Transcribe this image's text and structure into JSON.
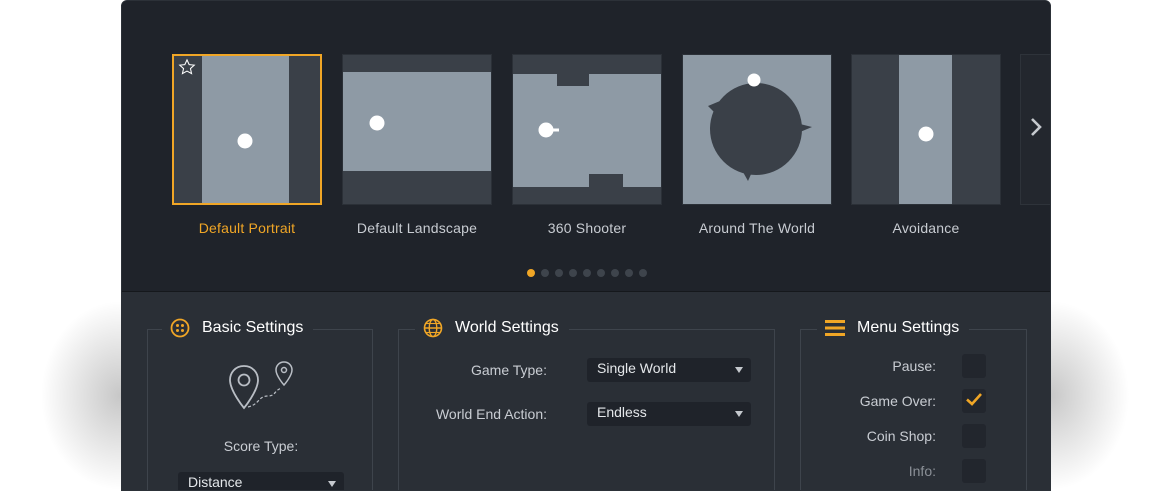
{
  "templates": [
    {
      "label": "Default  Portrait",
      "selected": true,
      "icon": "star-icon"
    },
    {
      "label": "Default  Landscape",
      "selected": false
    },
    {
      "label": "360 Shooter",
      "selected": false
    },
    {
      "label": "Around The World",
      "selected": false
    },
    {
      "label": "Avoidance",
      "selected": false
    }
  ],
  "pagination": {
    "total": 9,
    "active_index": 0
  },
  "basic_settings": {
    "title": "Basic Settings",
    "icon": "grid-circle-icon",
    "score_type_label": "Score Type:",
    "score_type_value": "Distance",
    "illustration": "map-pins-icon"
  },
  "world_settings": {
    "title": "World Settings",
    "icon": "globe-icon",
    "game_type_label": "Game Type:",
    "game_type_value": "Single World",
    "world_end_label": "World End Action:",
    "world_end_value": "Endless"
  },
  "menu_settings": {
    "title": "Menu Settings",
    "icon": "hamburger-icon",
    "items": [
      {
        "label": "Pause:",
        "checked": false,
        "disabled": false
      },
      {
        "label": "Game Over:",
        "checked": true,
        "disabled": false
      },
      {
        "label": "Coin Shop:",
        "checked": false,
        "disabled": false
      },
      {
        "label": "Info:",
        "checked": false,
        "disabled": true
      }
    ]
  },
  "colors": {
    "accent": "#f0a626",
    "background": "#1f232a",
    "panel": "#2a2f36",
    "thumb_light": "#8e9aa5",
    "thumb_dark": "#3a4048"
  }
}
